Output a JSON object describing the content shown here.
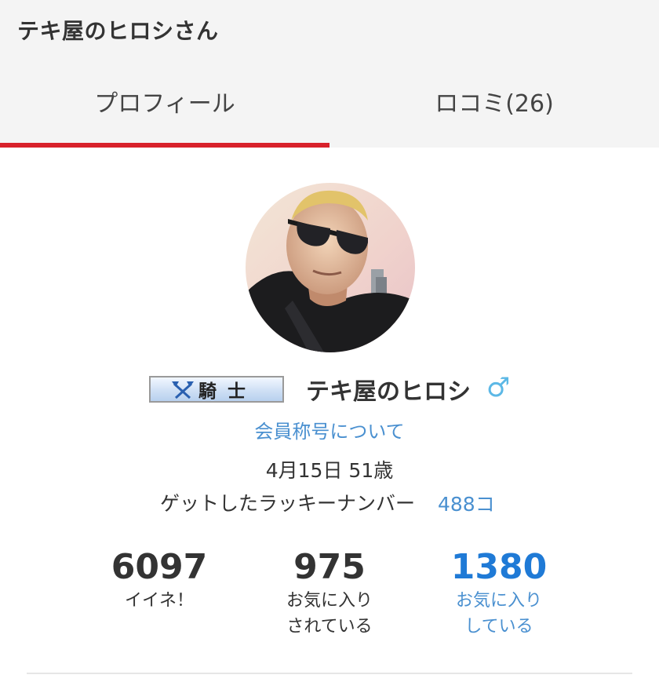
{
  "header": {
    "title": "テキ屋のヒロシさん"
  },
  "tabs": [
    {
      "label": "プロフィール",
      "active": true
    },
    {
      "label": "ロコミ(26)",
      "active": false
    }
  ],
  "profile": {
    "rank_badge": "騎士",
    "username": "テキ屋のヒロシ",
    "gender_icon": "male-icon",
    "title_link": "会員称号について",
    "birthday_age": "4月15日 51歳",
    "lucky_number_label": "ゲットしたラッキーナンバー",
    "lucky_number_value": "488コ"
  },
  "stats": [
    {
      "value": "6097",
      "label": "イイネ！"
    },
    {
      "value": "975",
      "label": "お気に入り\nされている"
    },
    {
      "value": "1380",
      "label": "お気に入り\nしている"
    }
  ],
  "colors": {
    "accent_red": "#d8212b",
    "link_blue": "#4a90d0",
    "stat_blue": "#1f7ad6",
    "male_blue": "#5cb8e6"
  }
}
